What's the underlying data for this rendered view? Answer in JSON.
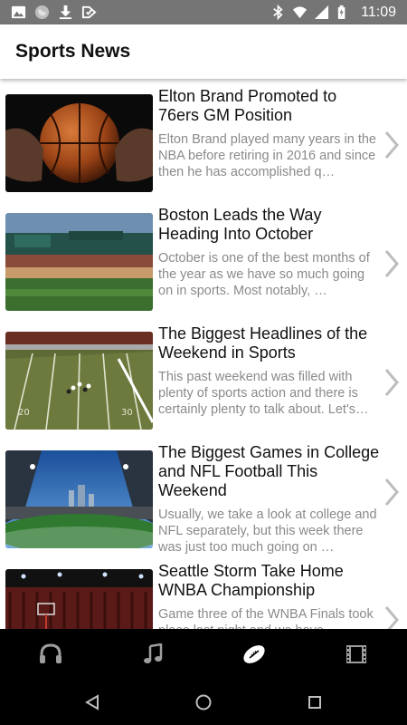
{
  "status_bar": {
    "time": "11:09",
    "left_icons": [
      "image-icon",
      "globe-icon",
      "download-icon",
      "check-icon"
    ],
    "right_icons": [
      "bluetooth-icon",
      "wifi-icon",
      "signal-icon",
      "battery-icon"
    ]
  },
  "app_bar": {
    "title": "Sports News"
  },
  "articles": [
    {
      "title": "Elton Brand Promoted to 76ers GM Position",
      "summary": "Elton Brand played many years in the NBA before retiring in 2016 and since then he has accomplished q…",
      "thumbnail": "basketball-in-hands"
    },
    {
      "title": "Boston Leads the Way Heading Into October",
      "summary": "October is one of the best months of the year as we have so much going on in sports. Most notably, …",
      "thumbnail": "baseball-stadium"
    },
    {
      "title": "The Biggest Headlines of the Weekend in Sports",
      "summary": "This past weekend was filled with plenty of sports action and there is certainly plenty to talk about. Let's…",
      "thumbnail": "football-field"
    },
    {
      "title": "The Biggest Games in College and NFL Football This Weekend",
      "summary": "Usually, we take a look at college and NFL separately, but this week there was just too much going on …",
      "thumbnail": "football-stadium-night"
    },
    {
      "title": "Seattle Storm Take Home WNBA Championship",
      "summary": "Game three of the WNBA Finals took place last night and we have …",
      "thumbnail": "basketball-arena"
    }
  ],
  "tabs": [
    {
      "name": "headphones",
      "icon": "headphones-icon",
      "selected": false
    },
    {
      "name": "music",
      "icon": "music-note-icon",
      "selected": false
    },
    {
      "name": "sports",
      "icon": "football-icon",
      "selected": true
    },
    {
      "name": "video",
      "icon": "film-icon",
      "selected": false
    }
  ],
  "nav": [
    "back-icon",
    "home-icon",
    "recents-icon"
  ],
  "colors": {
    "status_bar": "#757575",
    "title_text": "#111111",
    "summary_text": "#8a8a8a",
    "chevron": "#bdbdbd",
    "tab_bar": "#000000",
    "tab_icon": "#9e9e9e",
    "tab_icon_selected": "#ffffff"
  }
}
